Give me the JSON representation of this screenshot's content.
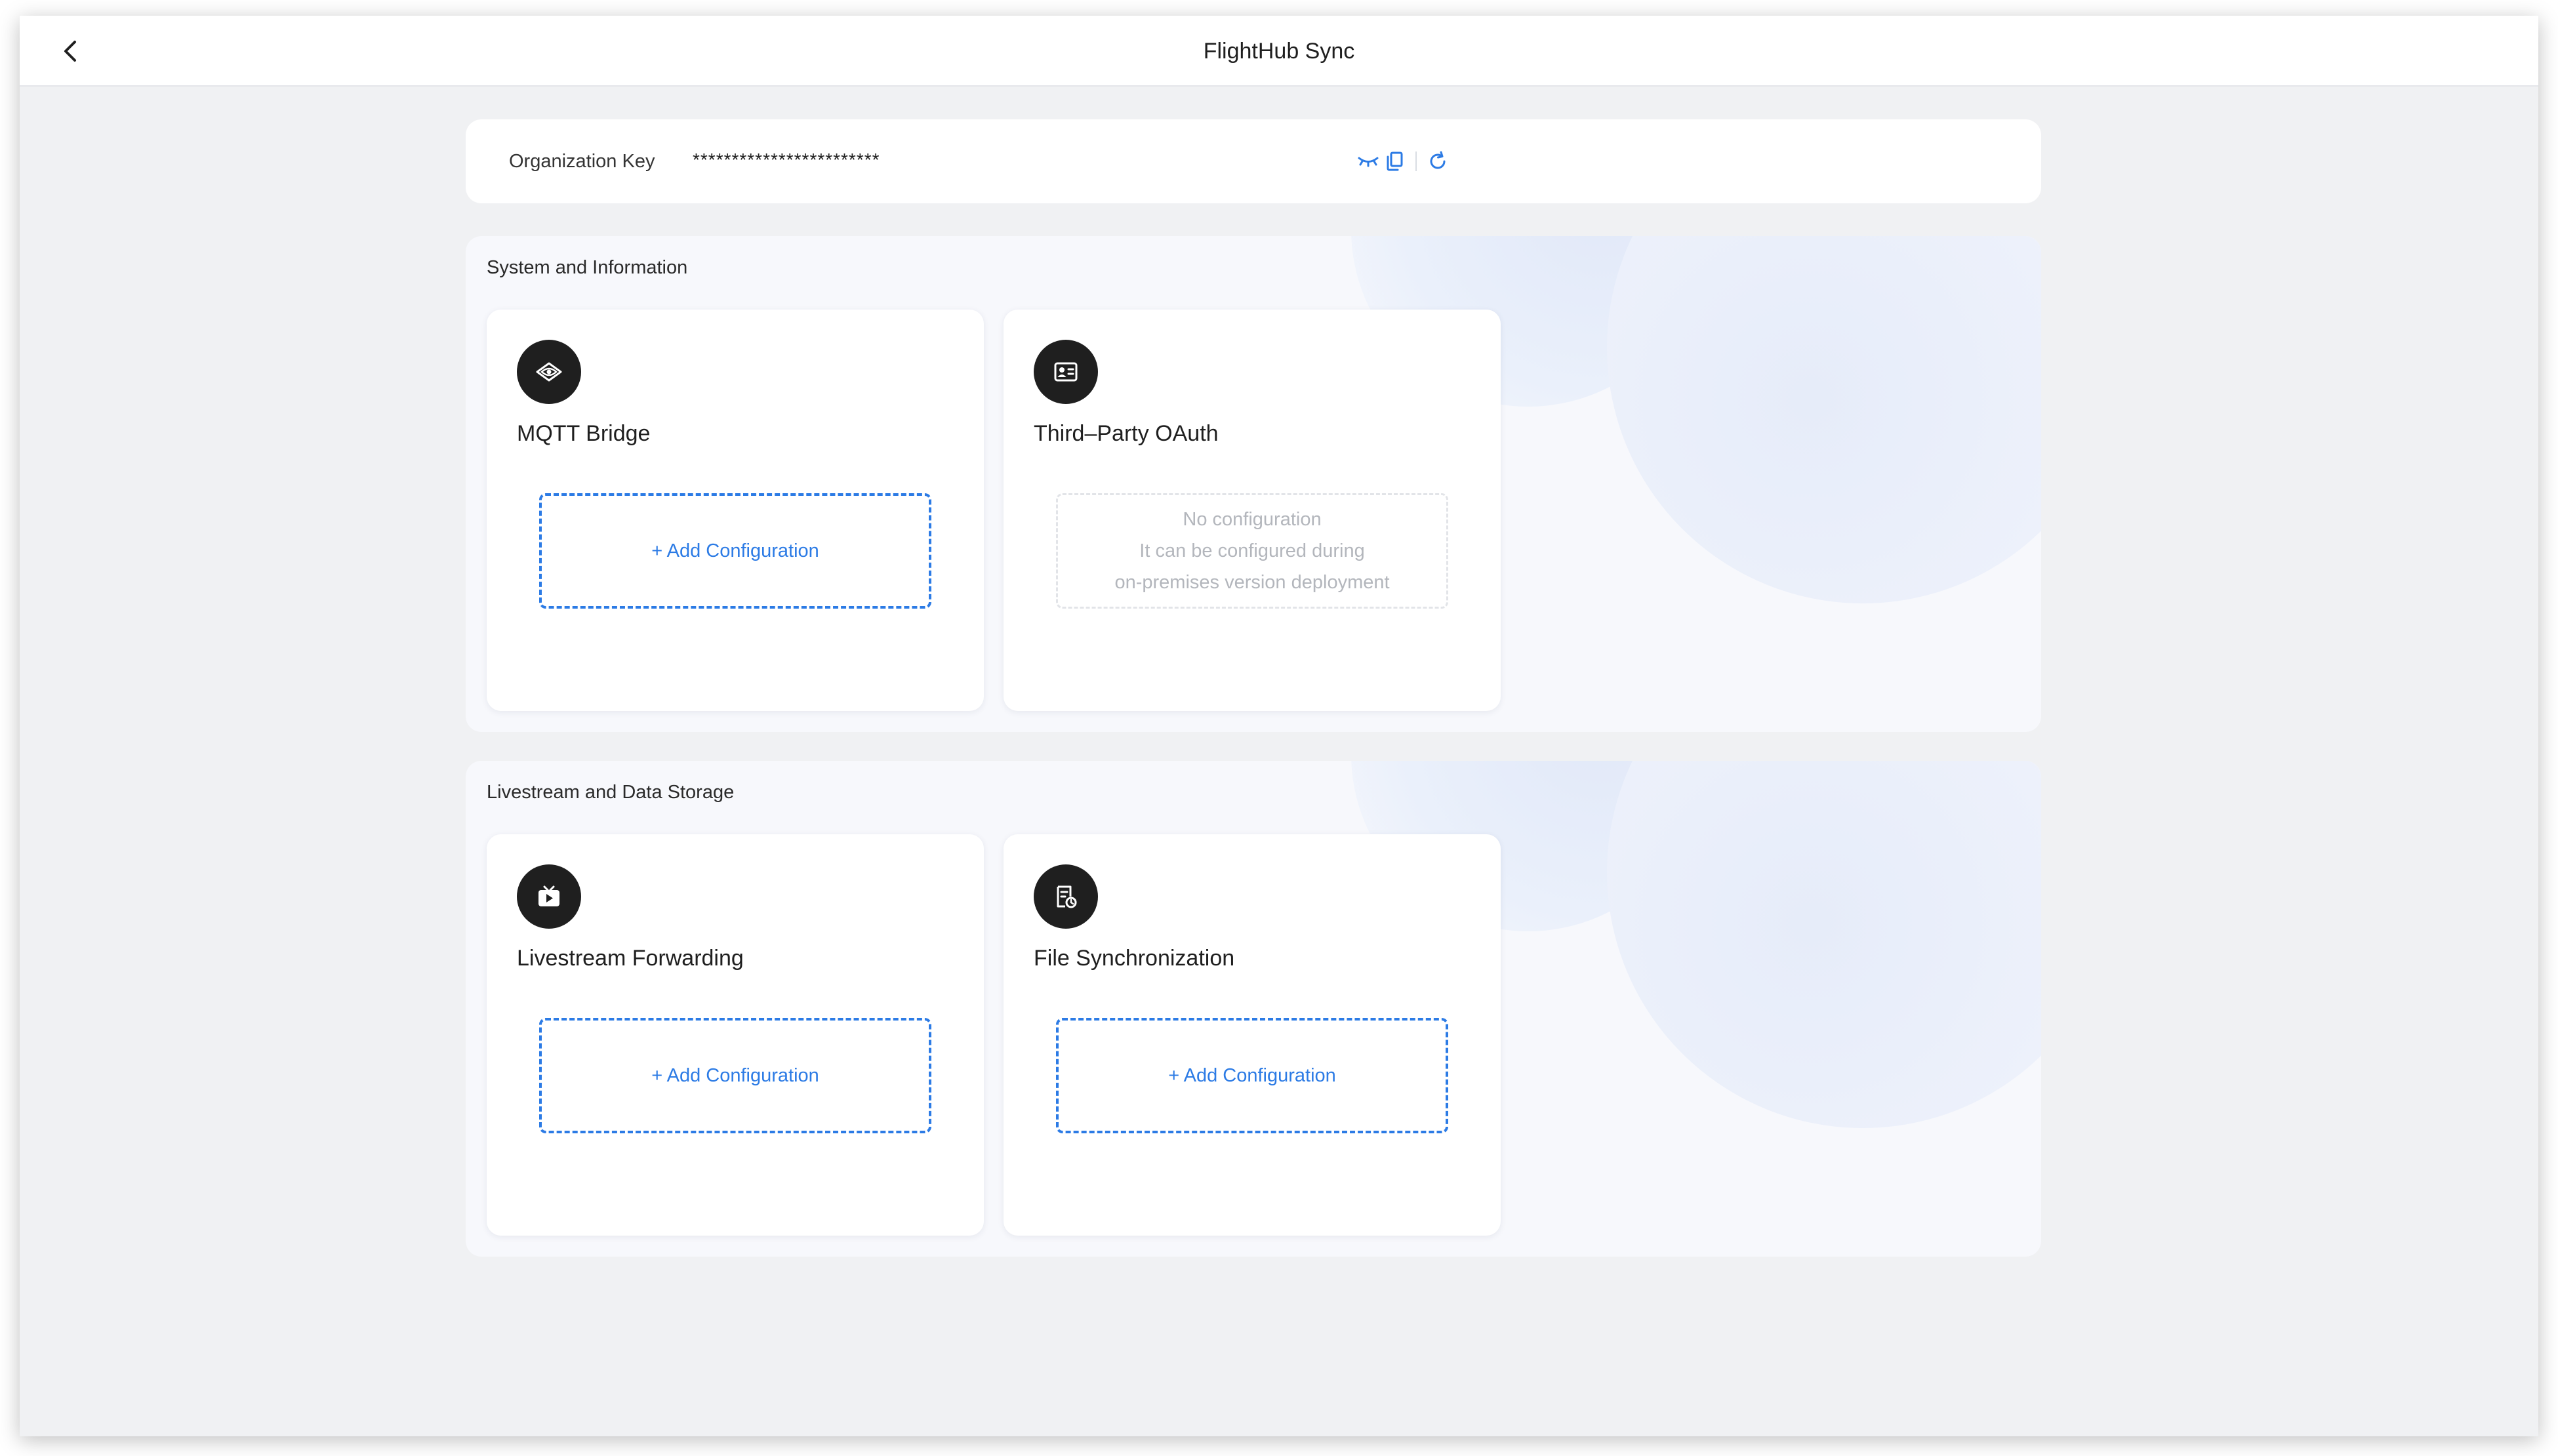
{
  "header": {
    "title": "FlightHub Sync"
  },
  "org_key": {
    "label": "Organization Key",
    "value": "************************"
  },
  "sections": [
    {
      "title": "System and Information",
      "cards": [
        {
          "title": "MQTT Bridge",
          "icon": "mqtt-bridge-icon",
          "action": "+ Add Configuration"
        },
        {
          "title": "Third–Party OAuth",
          "icon": "oauth-id-card-icon",
          "empty": [
            "No configuration",
            "It can be configured during",
            "on-premises version deployment"
          ]
        }
      ]
    },
    {
      "title": "Livestream and Data Storage",
      "cards": [
        {
          "title": "Livestream Forwarding",
          "icon": "livestream-tv-icon",
          "action": "+ Add Configuration"
        },
        {
          "title": "File Synchronization",
          "icon": "file-sync-icon",
          "action": "+ Add Configuration"
        }
      ]
    }
  ],
  "colors": {
    "accent": "#2c7be5",
    "background": "#f0f1f3",
    "icon_bg": "#1f1f1f"
  }
}
